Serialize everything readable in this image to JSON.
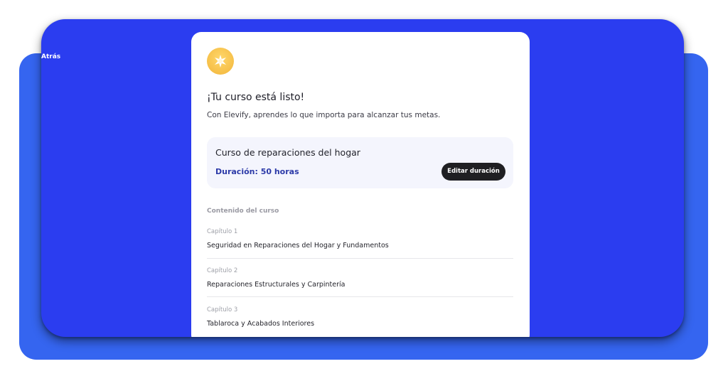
{
  "nav": {
    "back_label": "Atrás"
  },
  "card": {
    "title": "¡Tu curso está listo!",
    "subtitle": "Con Elevify, aprendes lo que importa para alcanzar tus metas.",
    "course": {
      "name": "Curso de reparaciones del hogar",
      "duration": "Duración: 50 horas",
      "edit_label": "Editar duración"
    },
    "content_title": "Contenido del curso",
    "chapters": [
      {
        "num": "Capítulo 1",
        "name": "Seguridad en Reparaciones del Hogar y Fundamentos"
      },
      {
        "num": "Capítulo 2",
        "name": "Reparaciones Estructurales y Carpintería"
      },
      {
        "num": "Capítulo 3",
        "name": "Tablaroca y Acabados Interiores"
      }
    ]
  },
  "colors": {
    "frame_blue": "#2b3df0",
    "back_blue": "#3565f0",
    "button_dark": "#1f1f22",
    "duration_text": "#2c3aa8",
    "logo_gold": "#f2b53a"
  },
  "icons": {
    "logo": "sunburst-logo-icon"
  }
}
